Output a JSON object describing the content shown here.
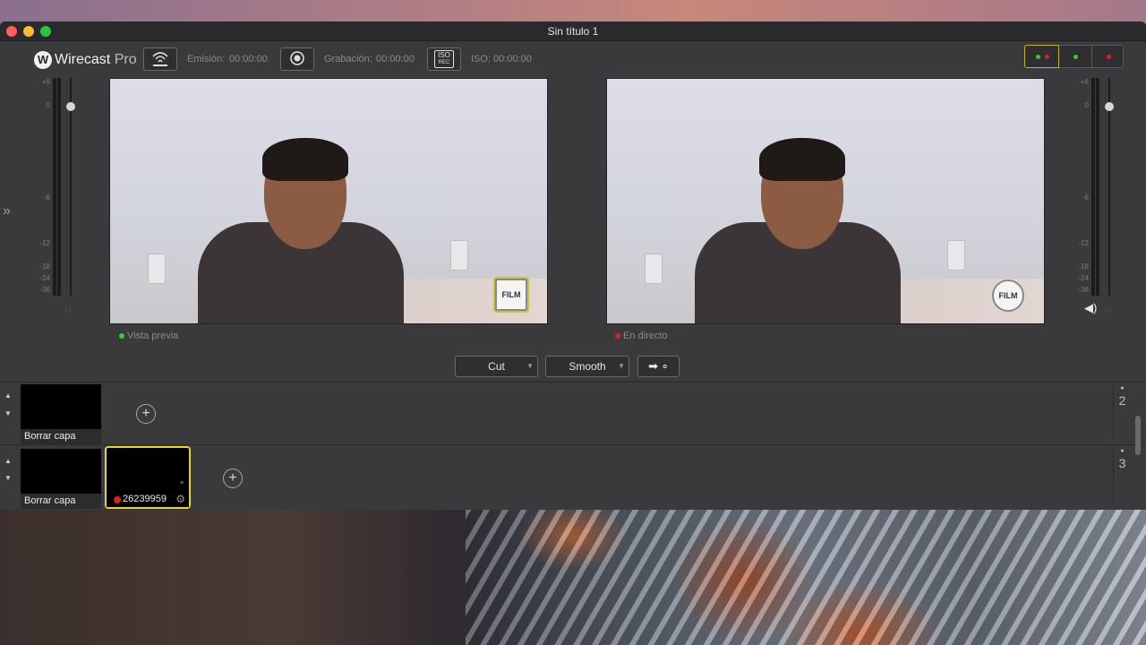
{
  "window": {
    "title": "Sin título 1"
  },
  "app": {
    "brand": "Wirecast",
    "edition": "Pro"
  },
  "toolbar": {
    "emission_label": "Emisión:",
    "emission_time": "00:00:00",
    "recording_label": "Grabación:",
    "recording_time": "00:00:00",
    "iso_badge_top": "ISO",
    "iso_badge_bottom": "REC",
    "iso_label": "ISO:",
    "iso_time": "00:00:00"
  },
  "meter_scale": [
    "+6",
    "0",
    "-6",
    "-12",
    "-18",
    "-24",
    "-36"
  ],
  "preview": {
    "label": "Vista previa",
    "status_color": "#2bd62b",
    "logo_text": "FILM"
  },
  "live": {
    "label": "En directo",
    "status_color": "#e02020",
    "logo_text": "FILM"
  },
  "transitions": {
    "first": "Cut",
    "second": "Smooth",
    "go_symbol": "➡ ∘"
  },
  "layers": [
    {
      "number": "2",
      "shots": [
        {
          "label": "Borrar capa"
        }
      ]
    },
    {
      "number": "3",
      "shots": [
        {
          "label": "Borrar capa"
        },
        {
          "label": "26239959",
          "selected": true
        }
      ]
    }
  ],
  "colors": {
    "selection": "#e5d62a",
    "live_red": "#e02020",
    "preview_green": "#2bd62b"
  }
}
